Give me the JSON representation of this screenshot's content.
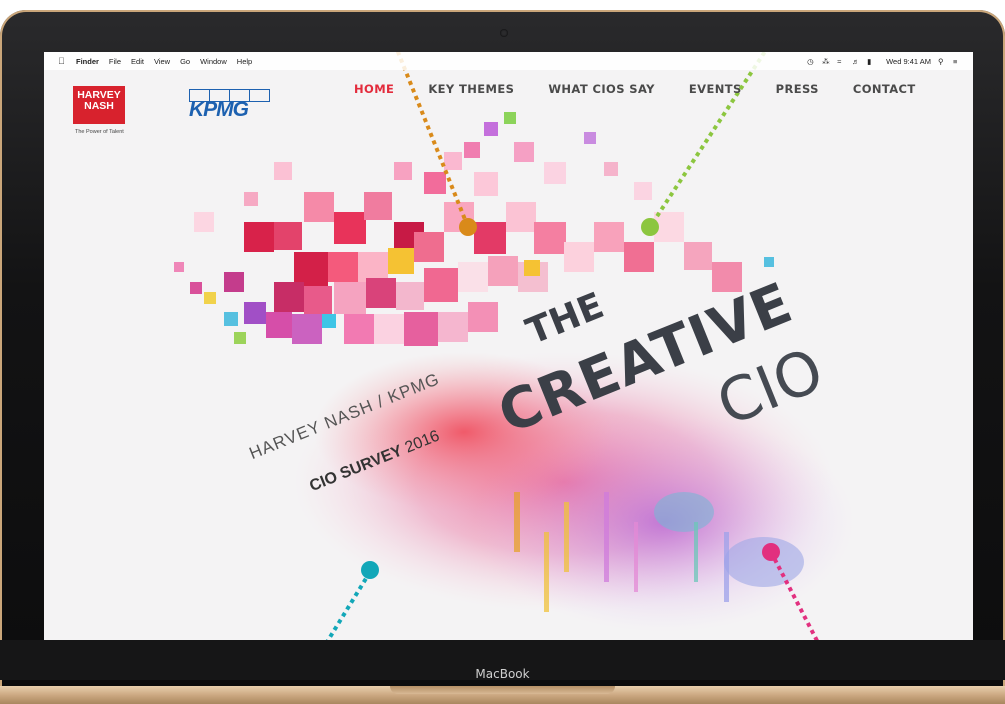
{
  "menubar": {
    "app": "Finder",
    "items": [
      "File",
      "Edit",
      "View",
      "Go",
      "Window",
      "Help"
    ],
    "clock": "Wed 9:41 AM"
  },
  "brand": {
    "harvey_nash_line1": "HARVEY",
    "harvey_nash_line2": "NASH",
    "harvey_nash_tagline": "The Power of Talent",
    "kpmg": "KPMG",
    "harvey_color": "#d8222d",
    "kpmg_color": "#1d61b0"
  },
  "nav": {
    "items": [
      "HOME",
      "KEY THEMES",
      "WHAT CIOS SAY",
      "EVENTS",
      "PRESS",
      "CONTACT"
    ],
    "active_color": "#e32b3c"
  },
  "hero": {
    "the": "THE",
    "creative": "CREATIVE",
    "cio": "CIO",
    "survey_line1": "HARVEY NASH / KPMG",
    "survey_bold": "CIO SURVEY",
    "survey_year": "2016"
  },
  "device": {
    "label": "MacBook"
  },
  "annotation_colors": [
    "#d98a1a",
    "#8cc63f",
    "#12a7b8",
    "#e2307f"
  ]
}
